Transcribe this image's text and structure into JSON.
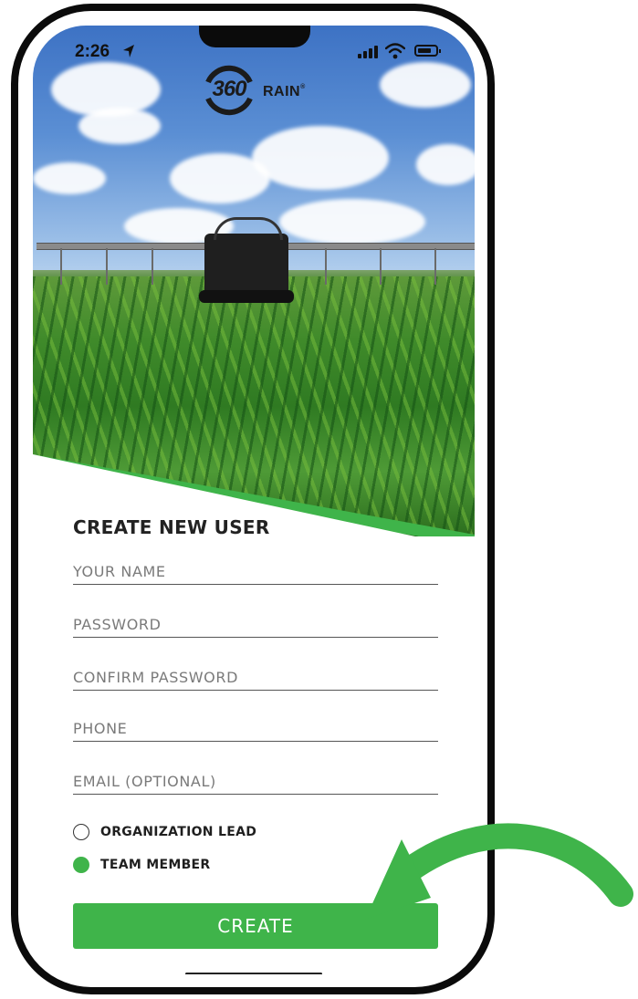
{
  "status_bar": {
    "time": "2:26",
    "icons": [
      "location-arrow-icon",
      "signal-icon",
      "wifi-icon",
      "battery-icon"
    ]
  },
  "brand": {
    "logo_number": "360",
    "logo_word": "RAIN",
    "logo_mark": "®"
  },
  "form": {
    "title": "CREATE NEW USER",
    "fields": [
      {
        "name": "name",
        "placeholder": "YOUR NAME",
        "value": ""
      },
      {
        "name": "password",
        "placeholder": "PASSWORD",
        "value": ""
      },
      {
        "name": "confirm_password",
        "placeholder": "CONFIRM PASSWORD",
        "value": ""
      },
      {
        "name": "phone",
        "placeholder": "PHONE",
        "value": ""
      },
      {
        "name": "email",
        "placeholder": "EMAIL (OPTIONAL)",
        "value": ""
      }
    ],
    "roles": [
      {
        "label": "ORGANIZATION LEAD",
        "selected": false
      },
      {
        "label": "TEAM MEMBER",
        "selected": true
      }
    ],
    "submit_label": "CREATE"
  },
  "colors": {
    "accent": "#3fb44a",
    "text": "#222222",
    "frame": "#0b0b0b"
  },
  "annotation": {
    "icon": "curved-arrow-icon",
    "color": "#3fb44a"
  }
}
